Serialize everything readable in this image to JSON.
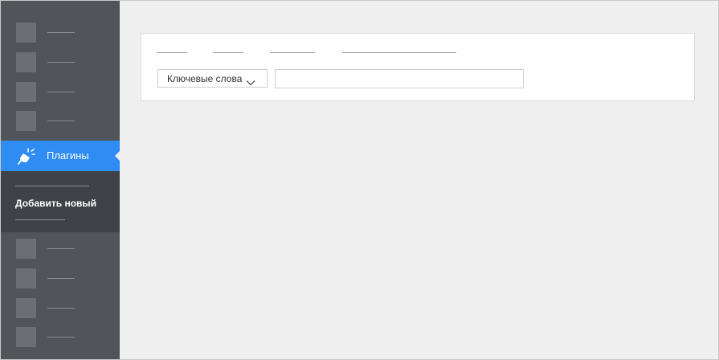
{
  "sidebar": {
    "active_item": {
      "label": "Плагины",
      "icon": "plug-icon"
    },
    "submenu": {
      "add_new_label": "Добавить новый"
    },
    "colors": {
      "background": "#51555a",
      "active": "#2f8cf2",
      "submenu": "#3f4348"
    }
  },
  "main": {
    "filter": {
      "selected": "Ключевые слова",
      "icon": "chevron-down-icon"
    },
    "search": {
      "value": "",
      "placeholder": ""
    }
  }
}
